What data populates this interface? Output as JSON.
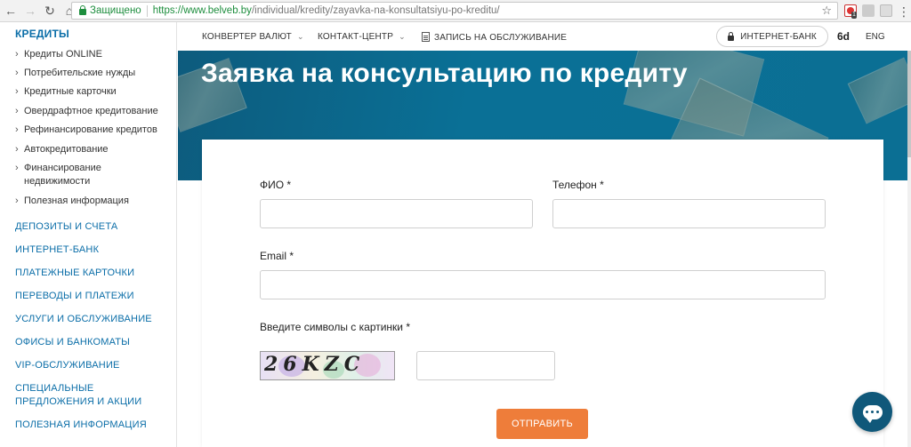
{
  "browser": {
    "secure_label": "Защищено",
    "url_host": "https://www.belveb.by",
    "url_path": "/individual/kredity/zayavka-na-konsultatsiyu-po-kreditu/",
    "ext_badge": "1"
  },
  "sidebar": {
    "heading": "КРЕДИТЫ",
    "sub_items": [
      {
        "label": "Кредиты ONLINE"
      },
      {
        "label": "Потребительские нужды"
      },
      {
        "label": "Кредитные карточки"
      },
      {
        "label": "Овердрафтное кредитование"
      },
      {
        "label": "Рефинансирование кредитов"
      },
      {
        "label": "Автокредитование"
      },
      {
        "label": "Финансирование\nнедвижимости"
      },
      {
        "label": "Полезная информация"
      }
    ],
    "main_items": [
      {
        "label": "ДЕПОЗИТЫ И СЧЕТА"
      },
      {
        "label": "ИНТЕРНЕТ-БАНК"
      },
      {
        "label": "ПЛАТЕЖНЫЕ КАРТОЧКИ"
      },
      {
        "label": "ПЕРЕВОДЫ И ПЛАТЕЖИ"
      },
      {
        "label": "УСЛУГИ И ОБСЛУЖИВАНИЕ"
      },
      {
        "label": "ОФИСЫ И БАНКОМАТЫ"
      },
      {
        "label": "VIP-ОБСЛУЖИВАНИЕ"
      },
      {
        "label": "СПЕЦИАЛЬНЫЕ\nПРЕДЛОЖЕНИЯ И АКЦИИ"
      },
      {
        "label": "ПОЛЕЗНАЯ ИНФОРМАЦИЯ"
      }
    ]
  },
  "topnav": {
    "currency_converter": "КОНВЕРТЕР ВАЛЮТ",
    "contact_center": "КОНТАКТ-ЦЕНТР",
    "service_booking": "ЗАПИСЬ НА ОБСЛУЖИВАНИЕ",
    "internet_bank": "ИНТЕРНЕТ-БАНК",
    "accessibility": "6d",
    "language": "ENG"
  },
  "hero": {
    "title": "Заявка на консультацию по кредиту"
  },
  "form": {
    "fio_label": "ФИО *",
    "fio_value": "",
    "phone_label": "Телефон *",
    "phone_value": "",
    "email_label": "Email *",
    "email_value": "",
    "captcha_label": "Введите символы с картинки *",
    "captcha_text": "26KZC",
    "captcha_value": "",
    "submit_label": "ОТПРАВИТЬ"
  },
  "colors": {
    "brand_blue": "#0b6ea8",
    "hero_teal": "#0a7096",
    "submit_orange": "#ee7d3a",
    "chat_navy": "#10587a"
  }
}
